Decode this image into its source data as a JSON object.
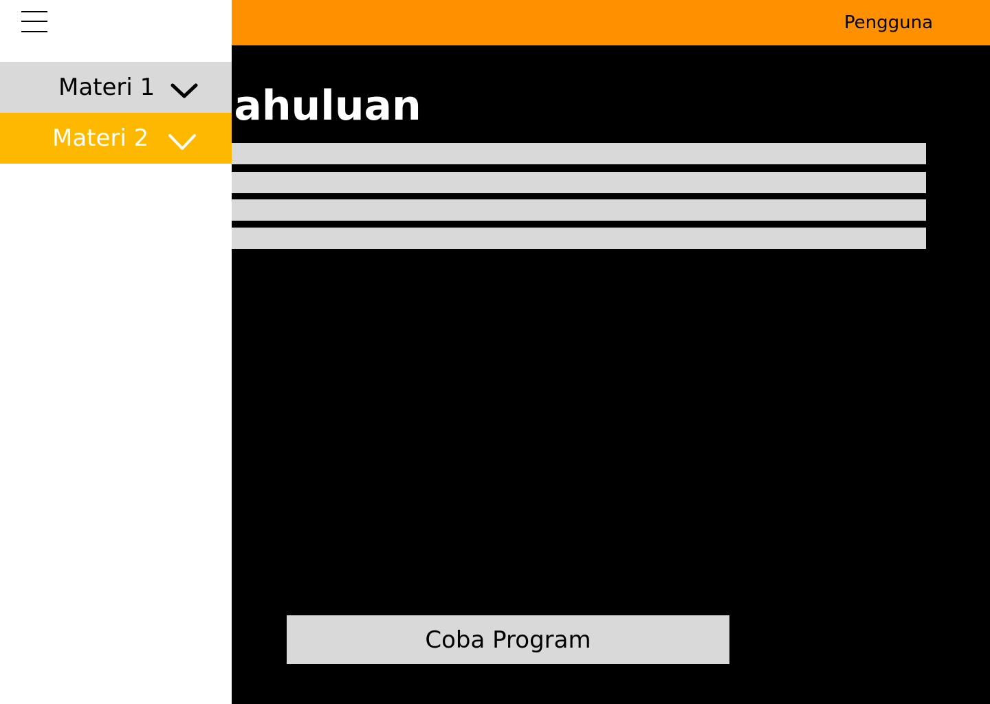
{
  "header": {
    "user_label": "Pengguna",
    "background_color": "#FF9100"
  },
  "content": {
    "title": "Pendahuluan",
    "text_placeholder_lines": 4,
    "action_button_label": "Coba Program"
  },
  "sidebar": {
    "menu_icon": "hamburger-icon",
    "items": [
      {
        "label": "Materi 1",
        "icon": "chevron-down-icon",
        "background_color": "#D9D9D9",
        "text_color": "#000000"
      },
      {
        "label": "Materi 2",
        "icon": "chevron-down-icon",
        "background_color": "#FFB800",
        "text_color": "#FFFFFF",
        "active": true
      }
    ]
  }
}
